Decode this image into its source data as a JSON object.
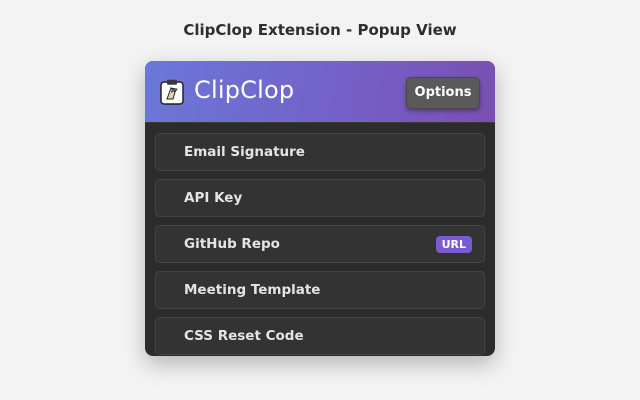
{
  "page_heading": "ClipClop Extension - Popup View",
  "header": {
    "logo_icon": "clipboard-icon",
    "title": "ClipClop",
    "options_label": "Options",
    "gradient_colors": [
      "#6a78d8",
      "#7a4fb3"
    ]
  },
  "clips": [
    {
      "label": "Email Signature",
      "badge": ""
    },
    {
      "label": "API Key",
      "badge": ""
    },
    {
      "label": "GitHub Repo",
      "badge": "URL"
    },
    {
      "label": "Meeting Template",
      "badge": ""
    },
    {
      "label": "CSS Reset Code",
      "badge": ""
    }
  ],
  "colors": {
    "popup_bg": "#2c2c2c",
    "item_bg": "#333333",
    "badge_bg": "#7a5ad0"
  }
}
